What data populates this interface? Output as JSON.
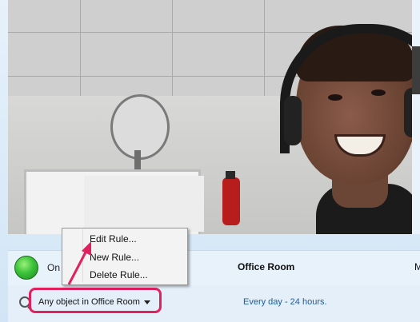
{
  "camera": {
    "status_label": "On",
    "name": "Office Room",
    "column_letter": "M",
    "object_filter": "Any object in Office Room",
    "schedule": "Every day - 24 hours."
  },
  "context_menu": {
    "items": [
      {
        "label": "Edit Rule..."
      },
      {
        "label": "New Rule..."
      },
      {
        "label": "Delete Rule..."
      }
    ]
  },
  "colors": {
    "highlight": "#e0215e",
    "status_on": "#3cc33a",
    "link": "#1d5c9c"
  },
  "icons": [
    "search-icon",
    "chevron-down-icon",
    "status-indicator",
    "arrow-annotation"
  ]
}
